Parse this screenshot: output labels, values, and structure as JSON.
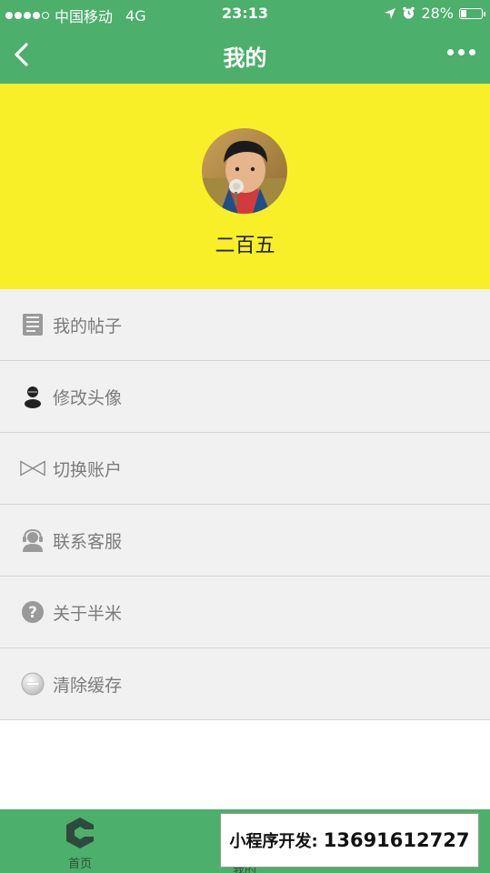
{
  "status_bar": {
    "carrier": "中国移动",
    "network": "4G",
    "time": "23:13",
    "battery_percent": "28%",
    "battery_level": 0.28,
    "signal_bars": 4
  },
  "nav": {
    "title": "我的",
    "back_icon": "chevron-left-icon",
    "more_icon": "more-dots-icon"
  },
  "profile": {
    "name": "二百五",
    "header_color": "#f9ef29",
    "avatar": "child-photo-avatar"
  },
  "menu": {
    "items": [
      {
        "label": "我的帖子",
        "icon": "document-list-icon"
      },
      {
        "label": "修改头像",
        "icon": "person-silhouette-icon"
      },
      {
        "label": "切换账户",
        "icon": "bowtie-swap-icon"
      },
      {
        "label": "联系客服",
        "icon": "headset-user-icon"
      },
      {
        "label": "关于半米",
        "icon": "question-circle-icon"
      },
      {
        "label": "清除缓存",
        "icon": "minus-circle-icon"
      }
    ]
  },
  "tab_bar": {
    "home_label": "首页",
    "home_icon": "c-logo-icon",
    "partial_label": "我的",
    "color": "#4caf6b"
  },
  "watermark": {
    "label": "小程序开发:",
    "phone": "13691612727"
  }
}
